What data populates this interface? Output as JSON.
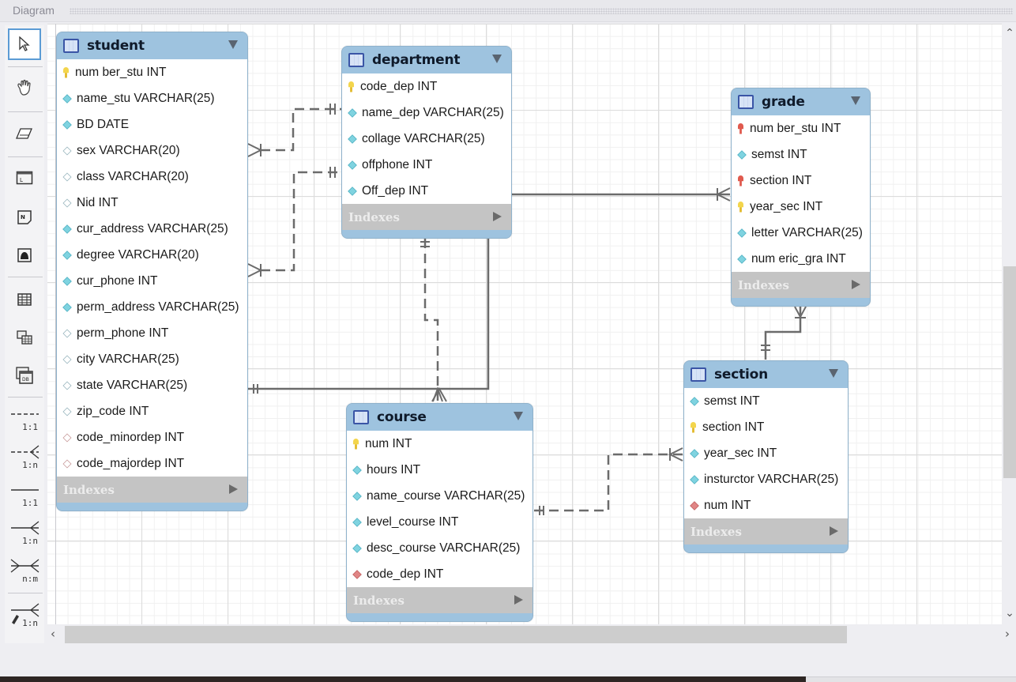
{
  "header": {
    "title": "Diagram"
  },
  "toolbar": {
    "tools": [
      {
        "name": "select-tool",
        "icon": "pointer-icon",
        "active": true
      },
      {
        "name": "hand-tool",
        "icon": "hand-icon"
      },
      {
        "name": "eraser-tool",
        "icon": "eraser-icon"
      },
      {
        "name": "layer-tool",
        "icon": "layer-icon",
        "glyph": "L"
      },
      {
        "name": "note-tool",
        "icon": "note-icon",
        "glyph": "N"
      },
      {
        "name": "image-tool",
        "icon": "image-icon"
      },
      {
        "name": "table-tool",
        "icon": "table-icon"
      },
      {
        "name": "view-tool",
        "icon": "view-icon"
      },
      {
        "name": "routine-group-tool",
        "icon": "routine-group-icon"
      }
    ],
    "relationships": [
      {
        "name": "rel-1-1-non-identifying",
        "label": "1:1",
        "style": "dashed"
      },
      {
        "name": "rel-1-n-non-identifying",
        "label": "1:n",
        "style": "dashed"
      },
      {
        "name": "rel-1-1-identifying",
        "label": "1:1",
        "style": "solid"
      },
      {
        "name": "rel-1-n-identifying",
        "label": "1:n",
        "style": "solid"
      },
      {
        "name": "rel-n-m-identifying",
        "label": "n:m",
        "style": "solid"
      },
      {
        "name": "rel-1-n-existing-columns",
        "label": "1:n",
        "style": "solid-pick"
      }
    ]
  },
  "tables": [
    {
      "id": "student",
      "name": "student",
      "indexes_label": "Indexes",
      "columns": [
        {
          "text": "num ber_stu INT",
          "icon": "key"
        },
        {
          "text": "name_stu VARCHAR(25)",
          "icon": "diamond-filled"
        },
        {
          "text": "BD DATE",
          "icon": "diamond-filled"
        },
        {
          "text": "sex VARCHAR(20)",
          "icon": "diamond-empty"
        },
        {
          "text": "class VARCHAR(20)",
          "icon": "diamond-empty"
        },
        {
          "text": "Nid INT",
          "icon": "diamond-empty"
        },
        {
          "text": "cur_address VARCHAR(25)",
          "icon": "diamond-filled"
        },
        {
          "text": "degree VARCHAR(20)",
          "icon": "diamond-filled"
        },
        {
          "text": "cur_phone INT",
          "icon": "diamond-filled"
        },
        {
          "text": "perm_address VARCHAR(25)",
          "icon": "diamond-filled"
        },
        {
          "text": "perm_phone INT",
          "icon": "diamond-empty"
        },
        {
          "text": "city VARCHAR(25)",
          "icon": "diamond-empty"
        },
        {
          "text": "state VARCHAR(25)",
          "icon": "diamond-empty"
        },
        {
          "text": "zip_code INT",
          "icon": "diamond-empty"
        },
        {
          "text": "code_minordep INT",
          "icon": "diamond-red-empty"
        },
        {
          "text": "code_majordep INT",
          "icon": "diamond-red-empty"
        }
      ]
    },
    {
      "id": "department",
      "name": "department",
      "indexes_label": "Indexes",
      "columns": [
        {
          "text": "code_dep INT",
          "icon": "key"
        },
        {
          "text": "name_dep VARCHAR(25)",
          "icon": "diamond-filled"
        },
        {
          "text": "collage VARCHAR(25)",
          "icon": "diamond-filled"
        },
        {
          "text": "offphone INT",
          "icon": "diamond-filled"
        },
        {
          "text": "Off_dep INT",
          "icon": "diamond-filled"
        }
      ]
    },
    {
      "id": "grade",
      "name": "grade",
      "indexes_label": "Indexes",
      "columns": [
        {
          "text": "num ber_stu INT",
          "icon": "key-red"
        },
        {
          "text": "semst INT",
          "icon": "diamond-filled"
        },
        {
          "text": "section INT",
          "icon": "key-red"
        },
        {
          "text": "year_sec INT",
          "icon": "key"
        },
        {
          "text": "letter VARCHAR(25)",
          "icon": "diamond-filled"
        },
        {
          "text": "num eric_gra INT",
          "icon": "diamond-filled"
        }
      ]
    },
    {
      "id": "section",
      "name": "section",
      "indexes_label": "Indexes",
      "columns": [
        {
          "text": "semst INT",
          "icon": "diamond-filled"
        },
        {
          "text": "section INT",
          "icon": "key"
        },
        {
          "text": "year_sec INT",
          "icon": "diamond-filled"
        },
        {
          "text": "insturctor VARCHAR(25)",
          "icon": "diamond-filled"
        },
        {
          "text": "num INT",
          "icon": "diamond-red"
        }
      ]
    },
    {
      "id": "course",
      "name": "course",
      "indexes_label": "Indexes",
      "columns": [
        {
          "text": "num INT",
          "icon": "key"
        },
        {
          "text": "hours INT",
          "icon": "diamond-filled"
        },
        {
          "text": "name_course VARCHAR(25)",
          "icon": "diamond-filled"
        },
        {
          "text": "level_course INT",
          "icon": "diamond-filled"
        },
        {
          "text": "desc_course VARCHAR(25)",
          "icon": "diamond-filled"
        },
        {
          "text": "code_dep INT",
          "icon": "diamond-red"
        }
      ]
    }
  ],
  "relationships": [
    {
      "name": "student-department-minor",
      "from": "department",
      "to": "student",
      "type": "1:n",
      "style": "dashed"
    },
    {
      "name": "student-department-major",
      "from": "department",
      "to": "student",
      "type": "1:n",
      "style": "dashed"
    },
    {
      "name": "department-grade",
      "from": "department",
      "to": "grade",
      "type": "1:n",
      "style": "solid"
    },
    {
      "name": "department-course",
      "from": "department",
      "to": "course",
      "type": "1:n",
      "style": "dashed"
    },
    {
      "name": "student-course",
      "from": "student",
      "to": "course",
      "type": "1:n",
      "style": "solid"
    },
    {
      "name": "section-grade",
      "from": "section",
      "to": "grade",
      "type": "1:n",
      "style": "solid"
    },
    {
      "name": "course-section",
      "from": "course",
      "to": "section",
      "type": "1:n",
      "style": "dashed"
    }
  ],
  "scrollbars": {
    "vertical": {
      "up": "^",
      "down": "v",
      "position_fraction": 0.45
    },
    "horizontal": {
      "left": "<",
      "right": ">",
      "position_fraction": 0.0
    }
  }
}
